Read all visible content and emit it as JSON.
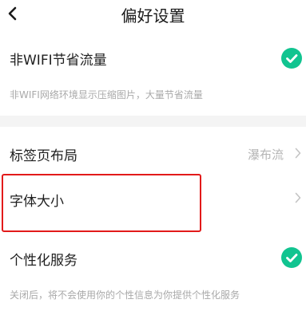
{
  "header": {
    "title": "偏好设置"
  },
  "settings": {
    "wifi_saver": {
      "label": "非WIFI节省流量",
      "description": "非WIFI网络环境显示压缩图片，大量节省流量",
      "checked": true
    },
    "tab_layout": {
      "label": "标签页布局",
      "value": "瀑布流"
    },
    "font_size": {
      "label": "字体大小"
    },
    "personalization": {
      "label": "个性化服务",
      "description": "关闭后，将不会使用你的个性信息为你提供个性化服务",
      "checked": true
    }
  },
  "colors": {
    "accent": "#11c490",
    "highlight": "#e21a1a"
  }
}
